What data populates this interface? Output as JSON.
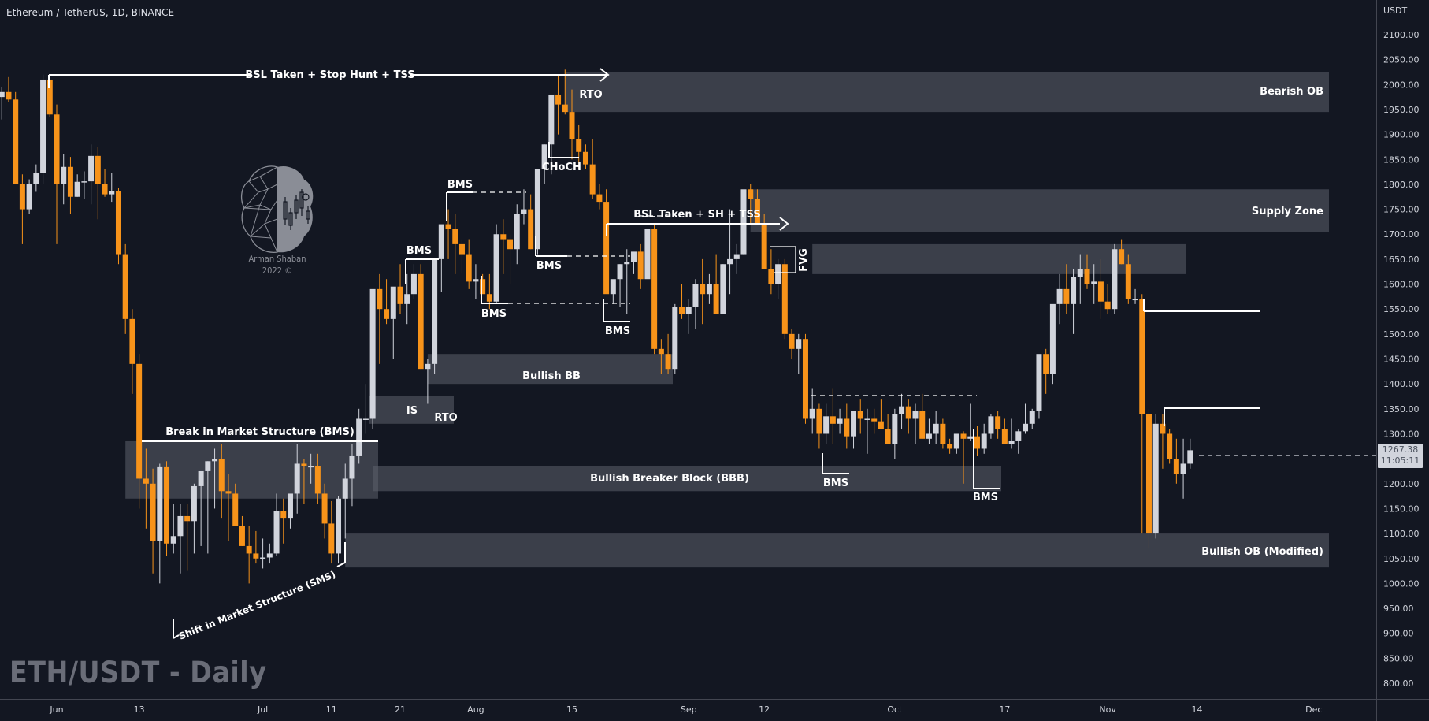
{
  "header": {
    "symbol_title": "Ethereum / TetherUS, 1D, BINANCE"
  },
  "watermark": "ETH/USDT - Daily",
  "logo": {
    "icon": "brain-candlestick-logo-icon",
    "author": "Arman Shaban",
    "year": "2022 ©"
  },
  "price_axis": {
    "unit": "USDT",
    "current_price": "1267.38",
    "countdown": "11:05:11"
  },
  "colors": {
    "background": "#131722",
    "bull": "#d1d4dc",
    "bear": "#f7931a",
    "zone": "#5d606b",
    "annotation": "#ffffff",
    "axis_text": "#d1d4dc"
  },
  "chart_data": {
    "type": "candlestick",
    "title": "Ethereum / TetherUS, 1D, BINANCE",
    "xlabel": "",
    "ylabel": "USDT",
    "ylim": [
      770,
      2130
    ],
    "grid": false,
    "y_ticks": [
      "2100.00",
      "2050.00",
      "2000.00",
      "1950.00",
      "1900.00",
      "1850.00",
      "1800.00",
      "1750.00",
      "1700.00",
      "1650.00",
      "1600.00",
      "1550.00",
      "1500.00",
      "1450.00",
      "1400.00",
      "1350.00",
      "1300.00",
      "1250.00",
      "1200.00",
      "1150.00",
      "1100.00",
      "1050.00",
      "1000.00",
      "950.00",
      "900.00",
      "850.00",
      "800.00"
    ],
    "x_ticks": [
      {
        "label": "Jun",
        "day": 0
      },
      {
        "label": "13",
        "day": 12
      },
      {
        "label": "Jul",
        "day": 30
      },
      {
        "label": "11",
        "day": 40
      },
      {
        "label": "21",
        "day": 50
      },
      {
        "label": "Aug",
        "day": 61
      },
      {
        "label": "15",
        "day": 75
      },
      {
        "label": "Sep",
        "day": 92
      },
      {
        "label": "12",
        "day": 103
      },
      {
        "label": "Oct",
        "day": 122
      },
      {
        "label": "17",
        "day": 138
      },
      {
        "label": "Nov",
        "day": 153
      },
      {
        "label": "14",
        "day": 166
      },
      {
        "label": "Dec",
        "day": 183
      }
    ],
    "first_day_offset": -8,
    "candles": [
      [
        1975,
        1995,
        1930,
        1985
      ],
      [
        1985,
        2015,
        1965,
        1970
      ],
      [
        1970,
        1985,
        1800,
        1800
      ],
      [
        1800,
        1820,
        1680,
        1750
      ],
      [
        1750,
        1810,
        1740,
        1800
      ],
      [
        1800,
        1840,
        1785,
        1822
      ],
      [
        1822,
        2020,
        1800,
        2010
      ],
      [
        2010,
        2020,
        1935,
        1940
      ],
      [
        1940,
        1960,
        1680,
        1800
      ],
      [
        1800,
        1860,
        1760,
        1835
      ],
      [
        1835,
        1855,
        1740,
        1775
      ],
      [
        1775,
        1820,
        1775,
        1805
      ],
      [
        1805,
        1826,
        1770,
        1806
      ],
      [
        1806,
        1880,
        1760,
        1857
      ],
      [
        1857,
        1875,
        1730,
        1800
      ],
      [
        1800,
        1830,
        1775,
        1780
      ],
      [
        1780,
        1822,
        1765,
        1786
      ],
      [
        1786,
        1793,
        1640,
        1660
      ],
      [
        1660,
        1680,
        1500,
        1530
      ],
      [
        1530,
        1550,
        1380,
        1440
      ],
      [
        1440,
        1460,
        1150,
        1210
      ],
      [
        1210,
        1270,
        1110,
        1200
      ],
      [
        1200,
        1230,
        1020,
        1085
      ],
      [
        1085,
        1240,
        1000,
        1233
      ],
      [
        1233,
        1245,
        1055,
        1080
      ],
      [
        1080,
        1160,
        1060,
        1095
      ],
      [
        1095,
        1160,
        1020,
        1135
      ],
      [
        1135,
        1160,
        1025,
        1125
      ],
      [
        1125,
        1200,
        1060,
        1195
      ],
      [
        1195,
        1215,
        1075,
        1225
      ],
      [
        1225,
        1245,
        1060,
        1245
      ],
      [
        1245,
        1270,
        1150,
        1250
      ],
      [
        1250,
        1280,
        1130,
        1185
      ],
      [
        1185,
        1220,
        1085,
        1180
      ],
      [
        1180,
        1200,
        1150,
        1115
      ],
      [
        1115,
        1135,
        1075,
        1075
      ],
      [
        1075,
        1115,
        1000,
        1060
      ],
      [
        1060,
        1105,
        1040,
        1050
      ],
      [
        1050,
        1090,
        1030,
        1052
      ],
      [
        1052,
        1080,
        1040,
        1060
      ],
      [
        1060,
        1180,
        1055,
        1145
      ],
      [
        1145,
        1170,
        1080,
        1130
      ],
      [
        1130,
        1165,
        1110,
        1180
      ],
      [
        1180,
        1280,
        1140,
        1240
      ],
      [
        1240,
        1250,
        1160,
        1235
      ],
      [
        1235,
        1260,
        1200,
        1235
      ],
      [
        1235,
        1260,
        1160,
        1180
      ],
      [
        1180,
        1200,
        1090,
        1120
      ],
      [
        1120,
        1165,
        1040,
        1060
      ],
      [
        1060,
        1175,
        1040,
        1170
      ],
      [
        1170,
        1240,
        1090,
        1210
      ],
      [
        1210,
        1280,
        1155,
        1255
      ],
      [
        1255,
        1350,
        1240,
        1330
      ],
      [
        1330,
        1400,
        1300,
        1330
      ],
      [
        1330,
        1560,
        1310,
        1590
      ],
      [
        1590,
        1620,
        1440,
        1550
      ],
      [
        1550,
        1610,
        1520,
        1530
      ],
      [
        1530,
        1580,
        1450,
        1595
      ],
      [
        1595,
        1640,
        1540,
        1560
      ],
      [
        1560,
        1620,
        1520,
        1580
      ],
      [
        1580,
        1640,
        1570,
        1620
      ],
      [
        1620,
        1640,
        1430,
        1430
      ],
      [
        1430,
        1450,
        1360,
        1440
      ],
      [
        1440,
        1600,
        1420,
        1650
      ],
      [
        1650,
        1700,
        1585,
        1720
      ],
      [
        1720,
        1750,
        1650,
        1710
      ],
      [
        1710,
        1740,
        1620,
        1680
      ],
      [
        1680,
        1690,
        1620,
        1660
      ],
      [
        1660,
        1690,
        1590,
        1605
      ],
      [
        1605,
        1640,
        1570,
        1610
      ],
      [
        1610,
        1620,
        1590,
        1580
      ],
      [
        1580,
        1620,
        1550,
        1565
      ],
      [
        1565,
        1720,
        1560,
        1700
      ],
      [
        1700,
        1730,
        1620,
        1690
      ],
      [
        1690,
        1700,
        1600,
        1670
      ],
      [
        1670,
        1760,
        1640,
        1740
      ],
      [
        1740,
        1790,
        1720,
        1750
      ],
      [
        1750,
        1780,
        1670,
        1670
      ],
      [
        1670,
        1740,
        1660,
        1830
      ],
      [
        1830,
        1880,
        1800,
        1880
      ],
      [
        1880,
        1920,
        1820,
        1980
      ],
      [
        1980,
        2020,
        1900,
        1960
      ],
      [
        1960,
        2030,
        1940,
        1945
      ],
      [
        1945,
        1990,
        1850,
        1890
      ],
      [
        1890,
        1920,
        1830,
        1865
      ],
      [
        1865,
        1880,
        1830,
        1840
      ],
      [
        1840,
        1890,
        1770,
        1780
      ],
      [
        1780,
        1800,
        1750,
        1765
      ],
      [
        1765,
        1790,
        1610,
        1580
      ],
      [
        1580,
        1600,
        1560,
        1610
      ],
      [
        1610,
        1640,
        1555,
        1640
      ],
      [
        1640,
        1670,
        1540,
        1645
      ],
      [
        1645,
        1660,
        1620,
        1665
      ],
      [
        1665,
        1680,
        1590,
        1610
      ],
      [
        1610,
        1690,
        1620,
        1710
      ],
      [
        1710,
        1720,
        1460,
        1470
      ],
      [
        1470,
        1490,
        1420,
        1460
      ],
      [
        1460,
        1500,
        1420,
        1430
      ],
      [
        1430,
        1560,
        1420,
        1555
      ],
      [
        1555,
        1600,
        1530,
        1540
      ],
      [
        1540,
        1570,
        1500,
        1555
      ],
      [
        1555,
        1610,
        1510,
        1600
      ],
      [
        1600,
        1650,
        1520,
        1580
      ],
      [
        1580,
        1620,
        1560,
        1600
      ],
      [
        1600,
        1660,
        1580,
        1540
      ],
      [
        1540,
        1640,
        1540,
        1640
      ],
      [
        1640,
        1750,
        1580,
        1650
      ],
      [
        1650,
        1680,
        1620,
        1660
      ],
      [
        1660,
        1740,
        1660,
        1790
      ],
      [
        1790,
        1800,
        1720,
        1770
      ],
      [
        1770,
        1790,
        1730,
        1720
      ],
      [
        1720,
        1740,
        1630,
        1630
      ],
      [
        1630,
        1670,
        1580,
        1600
      ],
      [
        1600,
        1650,
        1570,
        1640
      ],
      [
        1640,
        1650,
        1490,
        1500
      ],
      [
        1500,
        1510,
        1450,
        1470
      ],
      [
        1470,
        1500,
        1420,
        1490
      ],
      [
        1490,
        1500,
        1320,
        1330
      ],
      [
        1330,
        1390,
        1300,
        1350
      ],
      [
        1350,
        1360,
        1270,
        1300
      ],
      [
        1300,
        1360,
        1280,
        1335
      ],
      [
        1335,
        1390,
        1280,
        1320
      ],
      [
        1320,
        1350,
        1300,
        1330
      ],
      [
        1330,
        1360,
        1270,
        1295
      ],
      [
        1295,
        1340,
        1270,
        1345
      ],
      [
        1345,
        1370,
        1300,
        1330
      ],
      [
        1330,
        1350,
        1260,
        1330
      ],
      [
        1330,
        1350,
        1300,
        1325
      ],
      [
        1325,
        1370,
        1310,
        1310
      ],
      [
        1310,
        1340,
        1280,
        1280
      ],
      [
        1280,
        1350,
        1250,
        1340
      ],
      [
        1340,
        1380,
        1310,
        1355
      ],
      [
        1355,
        1370,
        1300,
        1330
      ],
      [
        1330,
        1360,
        1280,
        1345
      ],
      [
        1345,
        1380,
        1290,
        1290
      ],
      [
        1290,
        1330,
        1280,
        1300
      ],
      [
        1300,
        1345,
        1280,
        1320
      ],
      [
        1320,
        1330,
        1270,
        1280
      ],
      [
        1280,
        1290,
        1260,
        1270
      ],
      [
        1270,
        1300,
        1260,
        1300
      ],
      [
        1300,
        1305,
        1200,
        1290
      ],
      [
        1290,
        1360,
        1285,
        1295
      ],
      [
        1295,
        1315,
        1255,
        1270
      ],
      [
        1270,
        1320,
        1260,
        1300
      ],
      [
        1300,
        1340,
        1290,
        1335
      ],
      [
        1335,
        1345,
        1290,
        1310
      ],
      [
        1310,
        1330,
        1280,
        1280
      ],
      [
        1280,
        1330,
        1270,
        1285
      ],
      [
        1285,
        1310,
        1260,
        1305
      ],
      [
        1305,
        1360,
        1300,
        1320
      ],
      [
        1320,
        1350,
        1310,
        1345
      ],
      [
        1345,
        1380,
        1330,
        1460
      ],
      [
        1460,
        1470,
        1380,
        1420
      ],
      [
        1420,
        1520,
        1400,
        1560
      ],
      [
        1560,
        1620,
        1520,
        1590
      ],
      [
        1590,
        1640,
        1540,
        1560
      ],
      [
        1560,
        1630,
        1500,
        1615
      ],
      [
        1615,
        1660,
        1560,
        1630
      ],
      [
        1630,
        1660,
        1590,
        1600
      ],
      [
        1600,
        1640,
        1560,
        1605
      ],
      [
        1605,
        1650,
        1530,
        1565
      ],
      [
        1565,
        1600,
        1540,
        1550
      ],
      [
        1550,
        1680,
        1540,
        1670
      ],
      [
        1670,
        1690,
        1640,
        1640
      ],
      [
        1640,
        1660,
        1560,
        1570
      ],
      [
        1570,
        1590,
        1560,
        1570
      ],
      [
        1570,
        1580,
        1100,
        1340
      ],
      [
        1340,
        1350,
        1070,
        1100
      ],
      [
        1100,
        1340,
        1090,
        1320
      ],
      [
        1320,
        1340,
        1230,
        1300
      ],
      [
        1300,
        1310,
        1240,
        1250
      ],
      [
        1250,
        1290,
        1200,
        1220
      ],
      [
        1220,
        1290,
        1170,
        1240
      ],
      [
        1240,
        1290,
        1230,
        1267
      ]
    ],
    "annotations": {
      "zones": [
        {
          "label": "Bearish OB",
          "from_day": -8,
          "to_day": 193,
          "top": 2025,
          "bottom": 1945,
          "label_align": "right",
          "x_start": "day 74"
        },
        {
          "label": "Supply Zone",
          "from_day": 101,
          "to_day": 193,
          "top": 1790,
          "bottom": 1705
        },
        {
          "label": "",
          "from_day": 110,
          "to_day": 176,
          "top": 1680,
          "bottom": 1620
        },
        {
          "label": "Bullish BB",
          "from_day": 54,
          "to_day": 92,
          "top": 1460,
          "bottom": 1400
        },
        {
          "label": "IS",
          "from_day": 47,
          "to_day": 56,
          "top": 1375,
          "bottom": 1320
        },
        {
          "label": "Bullish Breaker Block (BBB)",
          "from_day": 46,
          "to_day": 142,
          "top": 1235,
          "bottom": 1185
        },
        {
          "label": "",
          "from_day": 10,
          "to_day": 47,
          "top": 1285,
          "bottom": 1170
        },
        {
          "label": "Bullish OB (Modified)",
          "from_day": 42,
          "to_day": 193,
          "top": 1100,
          "bottom": 1032
        }
      ],
      "labels": [
        "BSL Taken + Stop Hunt + TSS",
        "RTO",
        "CHoCH",
        "BMS",
        "BSL Taken + SH + TSS",
        "FVG",
        "Break in Market Structure (BMS)",
        "Shift in Market Structure (SMS)",
        "Bearish OB",
        "Supply Zone",
        "Bullish BB",
        "IS",
        "Bullish Breaker Block (BBB)",
        "Bullish OB (Modified)"
      ],
      "bms_count": 8,
      "rto_count": 2
    }
  }
}
